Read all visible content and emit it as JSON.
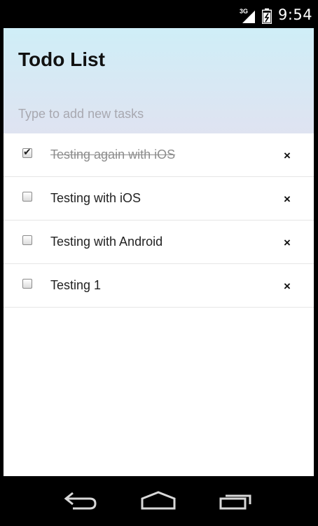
{
  "status_bar": {
    "network": "3G",
    "time": "9:54",
    "icons": [
      "signal-icon",
      "battery-icon"
    ]
  },
  "header": {
    "title": "Todo List",
    "input_placeholder": "Type to add new tasks"
  },
  "tasks": [
    {
      "text": "Testing again with iOS",
      "done": true,
      "delete_label": "×"
    },
    {
      "text": "Testing with iOS",
      "done": false,
      "delete_label": "×"
    },
    {
      "text": "Testing with Android",
      "done": false,
      "delete_label": "×"
    },
    {
      "text": "Testing 1",
      "done": false,
      "delete_label": "×"
    }
  ],
  "nav_bar": {
    "icons": [
      "back-icon",
      "home-icon",
      "recent-apps-icon"
    ]
  },
  "colors": {
    "header_gradient_top": "#cfeef7",
    "header_gradient_bottom": "#dfe3f1",
    "done_text": "#8d8d8d"
  }
}
